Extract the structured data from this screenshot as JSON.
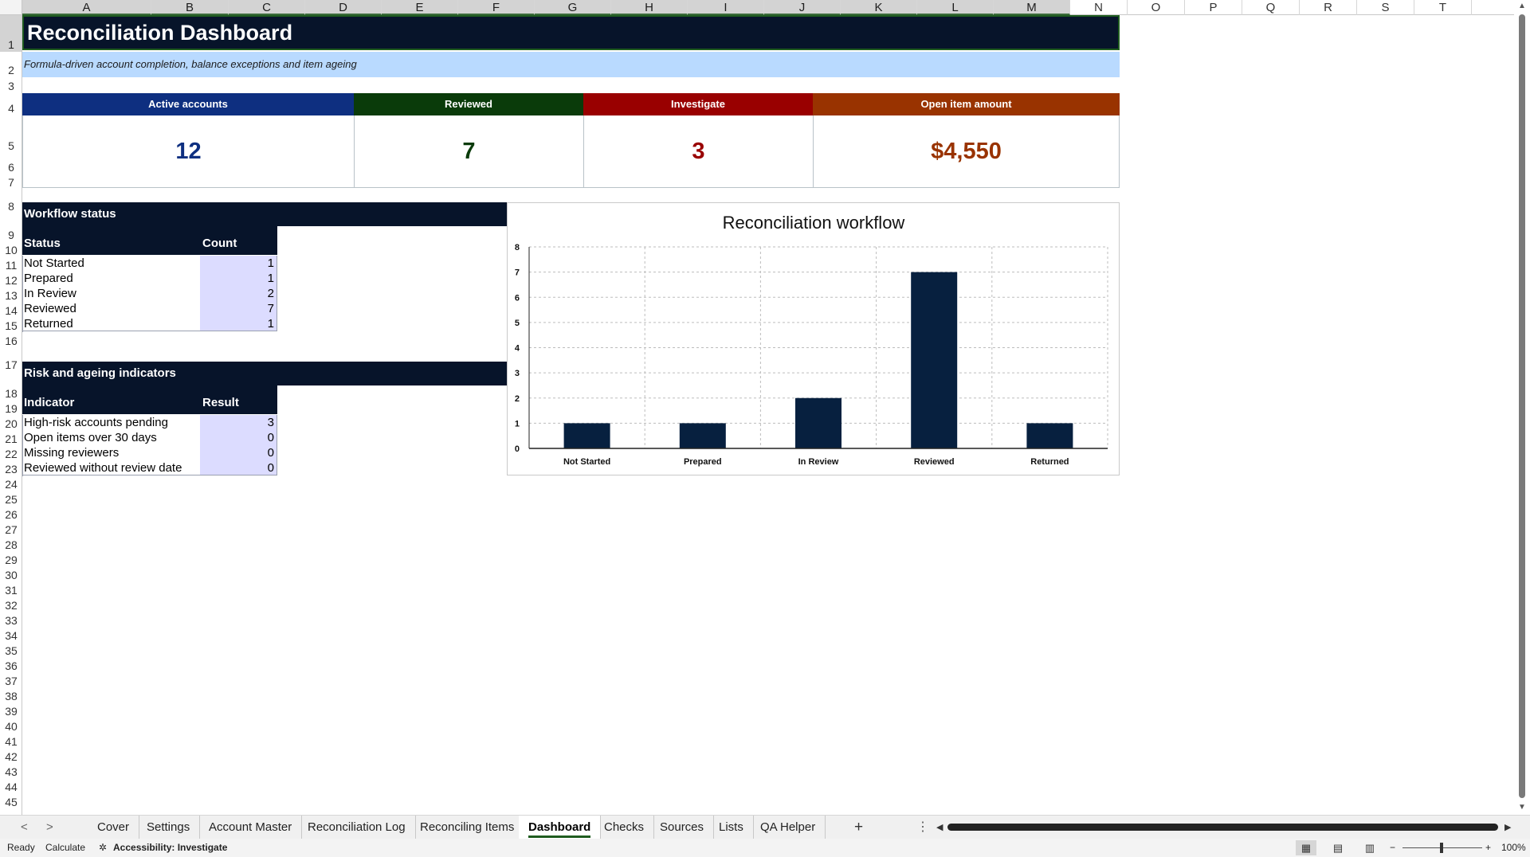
{
  "columns": [
    "A",
    "B",
    "C",
    "D",
    "E",
    "F",
    "G",
    "H",
    "I",
    "J",
    "K",
    "L",
    "M",
    "N",
    "O",
    "P",
    "Q",
    "R",
    "S",
    "T"
  ],
  "rows": [
    "1",
    "2",
    "3",
    "4",
    "5",
    "6",
    "7",
    "8",
    "9",
    "10",
    "11",
    "12",
    "13",
    "14",
    "15",
    "16",
    "17",
    "18",
    "19",
    "20",
    "21",
    "22",
    "23",
    "24",
    "25",
    "26",
    "27",
    "28",
    "29",
    "30",
    "31",
    "32",
    "33",
    "34",
    "35",
    "36",
    "37",
    "38",
    "39",
    "40",
    "41",
    "42",
    "43",
    "44",
    "45"
  ],
  "sheet": {
    "title": "Reconciliation Dashboard",
    "subtitle": "Formula-driven account completion, balance exceptions and item ageing",
    "kpis": [
      {
        "label": "Active accounts",
        "value": "12",
        "head_color": "#0e2f80",
        "value_color": "#0e2f80"
      },
      {
        "label": "Reviewed",
        "value": "7",
        "head_color": "#0a3b0a",
        "value_color": "#0a3b0a"
      },
      {
        "label": "Investigate",
        "value": "3",
        "head_color": "#990000",
        "value_color": "#990000"
      },
      {
        "label": "Open item amount",
        "value": "$4,550",
        "head_color": "#993300",
        "value_color": "#993300"
      }
    ],
    "workflow": {
      "section_title": "Workflow status",
      "col_label": "Status",
      "col_value": "Count",
      "rows": [
        {
          "label": "Not Started",
          "value": "1"
        },
        {
          "label": "Prepared",
          "value": "1"
        },
        {
          "label": "In Review",
          "value": "2"
        },
        {
          "label": "Reviewed",
          "value": "7"
        },
        {
          "label": "Returned",
          "value": "1"
        }
      ]
    },
    "risk": {
      "section_title": "Risk and ageing indicators",
      "col_label": "Indicator",
      "col_value": "Result",
      "rows": [
        {
          "label": "High-risk accounts pending",
          "value": "3"
        },
        {
          "label": "Open items over 30 days",
          "value": "0"
        },
        {
          "label": "Missing reviewers",
          "value": "0"
        },
        {
          "label": "Reviewed without review date",
          "value": "0"
        }
      ]
    }
  },
  "chart_data": {
    "type": "bar",
    "title": "Reconciliation workflow",
    "categories": [
      "Not Started",
      "Prepared",
      "In Review",
      "Reviewed",
      "Returned"
    ],
    "values": [
      1,
      1,
      2,
      7,
      1
    ],
    "xlabel": "",
    "ylabel": "",
    "ylim": [
      0,
      8
    ],
    "yticks": [
      "0",
      "1",
      "2",
      "3",
      "4",
      "5",
      "6",
      "7",
      "8"
    ],
    "grid": true,
    "bar_color": "#07203f"
  },
  "tabs": {
    "items": [
      "Cover",
      "Settings",
      "Account Master",
      "Reconciliation Log",
      "Reconciling Items",
      "Dashboard",
      "Checks",
      "Sources",
      "Lists",
      "QA Helper"
    ],
    "active": "Dashboard",
    "add": "+",
    "more": "⋮"
  },
  "status": {
    "ready": "Ready",
    "calculate": "Calculate",
    "accessibility": "Accessibility: Investigate",
    "zoom": "100%"
  }
}
